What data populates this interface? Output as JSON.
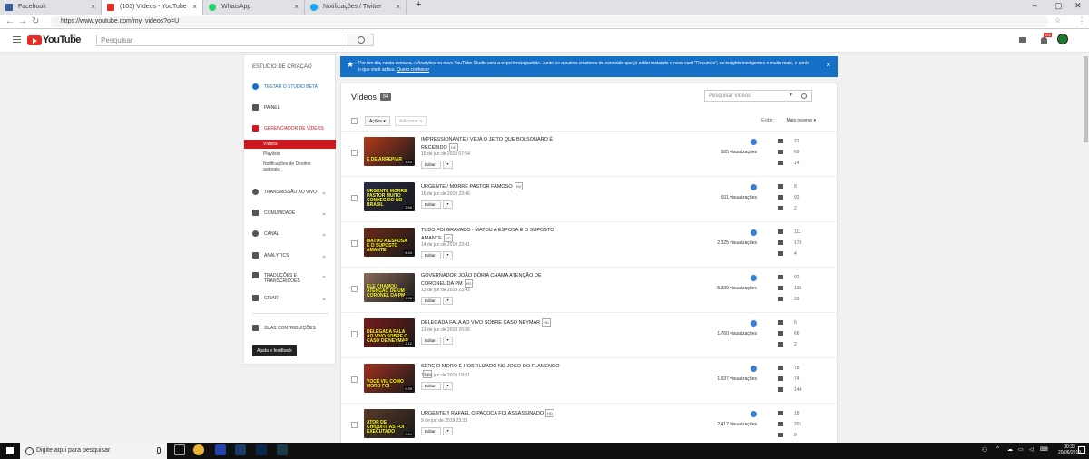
{
  "browser": {
    "tabs": [
      {
        "title": "Facebook",
        "color": "#3b5998",
        "icon": "facebook-icon"
      },
      {
        "title": "(103) Vídeos - YouTube",
        "color": "#e52d27",
        "icon": "youtube-icon"
      },
      {
        "title": "WhatsApp",
        "color": "#25d366",
        "icon": "whatsapp-icon"
      },
      {
        "title": "Notificações / Twitter",
        "color": "#1da1f2",
        "icon": "twitter-icon"
      }
    ],
    "url": "https://www.youtube.com/my_videos?o=U"
  },
  "header": {
    "logo": "YouTube",
    "region": "BR",
    "search_placeholder": "Pesquisar",
    "notification_badge": "103"
  },
  "sidebar": {
    "title": "ESTÚDIO DE CRIAÇÃO",
    "beta": "TESTAR O STUDIO BETA",
    "panel": "PAINEL",
    "manager": "GERENCIADOR DE VÍDEOS",
    "manager_sub": [
      "Vídeos",
      "Playlists",
      "Notificações de Direitos autorais"
    ],
    "sections": [
      "TRANSMISSÃO AO VIVO",
      "COMUNIDADE",
      "CANAL",
      "ANALYTICS",
      "TRADUÇÕES E TRANSCRIÇÕES",
      "CRIAR"
    ],
    "contrib": "SUAS CONTRIBUIÇÕES",
    "help": "Ajuda e feedback"
  },
  "banner": {
    "text": "Por um dia, nesta semana, o Analytics no novo YouTube Studio será a experiência padrão. Junte-se a outros criadores de conteúdo que já estão testando o novo card \"Resumos\", os insights inteligentes e muito mais, e conte o que você achou.",
    "link": "Quero conhecer"
  },
  "videos": {
    "title": "Vídeos",
    "count": "84",
    "search_placeholder": "Pesquisar vídeos",
    "actions": "Ações",
    "add_to": "Adicionar a",
    "sort_label": "Exibir:",
    "sort_value": "Mais recente",
    "edit_label": "Editar",
    "hd": "HD",
    "items": [
      {
        "title": "IMPRESSIONANTE / VEJA O JEITO QUE BOLSONARO É RECEBIDO",
        "date": "15 de jun de 2019 07:54",
        "views": "585 visualizações",
        "comments": "31",
        "likes": "69",
        "dislikes": "14",
        "thumb_text": "E DE ARREPIAR",
        "duration": "3:53",
        "thumb_color": "#b33a1a"
      },
      {
        "title": "URGENTE / MORRE PASTOR FAMOSO",
        "date": "16 de jun de 2019 23:46",
        "views": "911 visualizações",
        "comments": "8",
        "likes": "92",
        "dislikes": "2",
        "thumb_text": "URGENTE MORRE PASTOR MUITO CONHECIDO NO BRASIL",
        "duration": "2:56",
        "thumb_color": "#2a2a4a"
      },
      {
        "title": "TUDO FOI GRAVADO - MATOU A ESPOSA E O SUPOSTO AMANTE",
        "date": "14 de jun de 2019 23:41",
        "views": "2.025 visualizações",
        "comments": "111",
        "likes": "178",
        "dislikes": "4",
        "thumb_text": "MATOU A ESPOSA E O SUPOSTO AMANTE",
        "duration": "6:43",
        "thumb_color": "#6a2a1a"
      },
      {
        "title": "GOVERNADOR JOÃO DÓRIA CHAMA ATENÇÃO DE CORONEL DA PM",
        "date": "13 de jun de 2019 23:42",
        "views": "5.339 visualizações",
        "comments": "92",
        "likes": "135",
        "dislikes": "59",
        "thumb_text": "ELE CHAMOU ATENÇÃO DE UM CORONEL DA PM",
        "duration": "1:38",
        "thumb_color": "#8a6a5a"
      },
      {
        "title": "DELEGADA FALA AO VIVO SOBRE CASO NEYMAR",
        "date": "13 de jun de 2019 20:06",
        "views": "1.760 visualizações",
        "comments": "6",
        "likes": "66",
        "dislikes": "2",
        "thumb_text": "DELEGADA FALA AO VIVO SOBRE O CASO DE NEYMAR",
        "duration": "2:12",
        "thumb_color": "#7a1a1a"
      },
      {
        "title": "SERGIO MORO É HOSTILIZADO NO JOGO DO FLAMENGO",
        "date": "13 de jun de 2019 18:51",
        "views": "1.637 visualizações",
        "comments": "78",
        "likes": "74",
        "dislikes": "144",
        "thumb_text": "VOCÊ VIU COMO MORO FOI",
        "duration": "0:39",
        "thumb_color": "#a03020"
      },
      {
        "title": "URGENTE !! RAFAEL O PAÇOCA FOI ASSASSINADO",
        "date": "9 de jun de 2019 23:23",
        "views": "2.417 visualizações",
        "comments": "18",
        "likes": "201",
        "dislikes": "9",
        "thumb_text": "ATOR DE CHIQUITITAS FOI EXECUTADO",
        "duration": "0:54",
        "thumb_color": "#5a3a2a"
      }
    ]
  },
  "taskbar": {
    "search": "Digite aqui para pesquisar",
    "time": "00:33",
    "date": "20/06/2019"
  }
}
